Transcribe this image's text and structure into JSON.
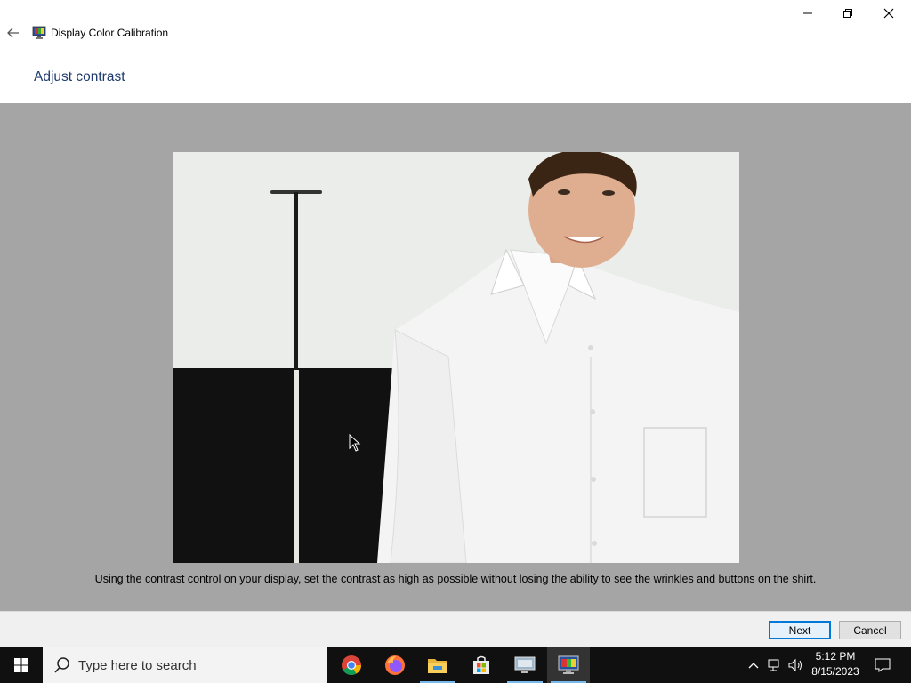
{
  "window": {
    "title": "Display Color Calibration",
    "heading": "Adjust contrast",
    "instruction": "Using the contrast control on your display, set the contrast as high as possible without losing the ability to see the wrinkles and buttons on the shirt.",
    "buttons": {
      "next": "Next",
      "cancel": "Cancel"
    },
    "icons": {
      "back": "back-arrow-icon",
      "app": "display-calibration-icon",
      "minimize": "minimize-icon",
      "maximize": "restore-icon",
      "close": "close-icon"
    }
  },
  "taskbar": {
    "search_placeholder": "Type here to search",
    "apps": [
      "Chrome",
      "Firefox",
      "File Explorer",
      "Microsoft Store",
      "Remote Desktop",
      "Display Color Calibration"
    ],
    "clock": {
      "time": "5:12 PM",
      "date": "8/15/2023"
    }
  },
  "colors": {
    "accent": "#0078d7",
    "heading": "#1e3a6e",
    "content_bg": "#a5a5a5",
    "taskbar": "#101010"
  }
}
